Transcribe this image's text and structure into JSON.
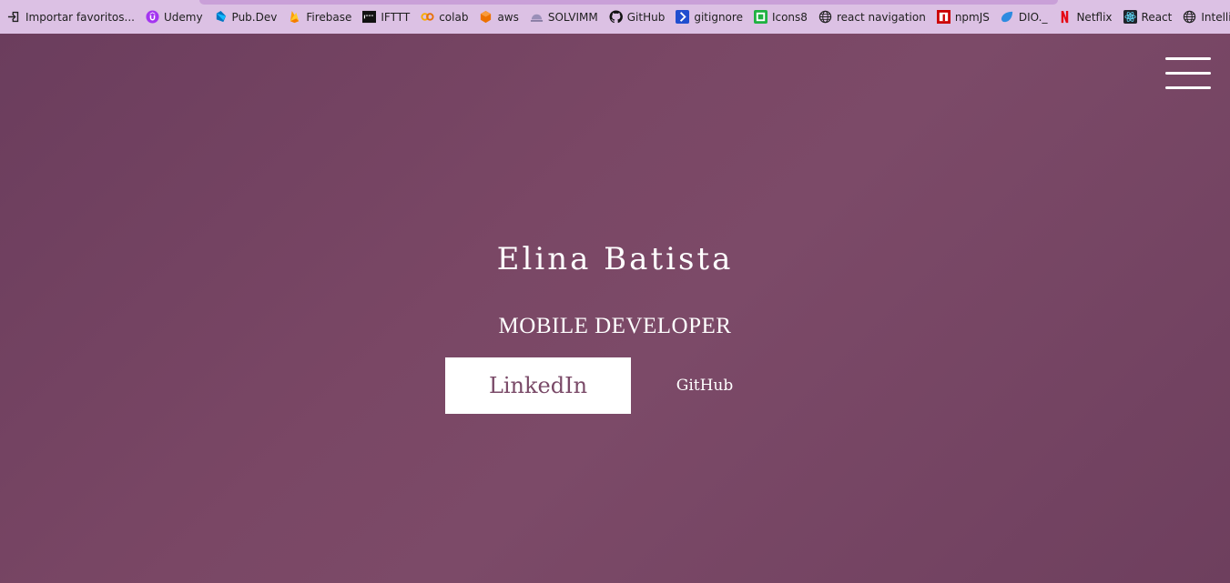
{
  "bookmarks": [
    {
      "label": "Importar favoritos...",
      "icon": "import-icon"
    },
    {
      "label": "Udemy",
      "icon": "udemy-icon"
    },
    {
      "label": "Pub.Dev",
      "icon": "dart-icon"
    },
    {
      "label": "Firebase",
      "icon": "firebase-icon"
    },
    {
      "label": "IFTTT",
      "icon": "ifttt-icon"
    },
    {
      "label": "colab",
      "icon": "colab-icon"
    },
    {
      "label": "aws",
      "icon": "aws-icon"
    },
    {
      "label": "SOLVIMM",
      "icon": "solvimm-icon"
    },
    {
      "label": "GitHub",
      "icon": "github-icon"
    },
    {
      "label": "gitignore",
      "icon": "gitignore-icon"
    },
    {
      "label": "Icons8",
      "icon": "icons8-icon"
    },
    {
      "label": "react navigation",
      "icon": "globe-icon"
    },
    {
      "label": "npmJS",
      "icon": "npm-icon"
    },
    {
      "label": "DIO._",
      "icon": "dio-icon"
    },
    {
      "label": "Netflix",
      "icon": "netflix-icon"
    },
    {
      "label": "React",
      "icon": "react-icon"
    },
    {
      "label": "IntelliJ atalhos",
      "icon": "globe-icon"
    }
  ],
  "hero": {
    "name": "Elina Batista",
    "role": "MOBILE DEVELOPER",
    "linkedin_label": "LinkedIn",
    "github_label": "GitHub"
  },
  "colors": {
    "bookmark_bar": "#dcc1e4",
    "hero_bg": "#714260",
    "accent": "#7a4a68",
    "text": "#ffffff"
  }
}
